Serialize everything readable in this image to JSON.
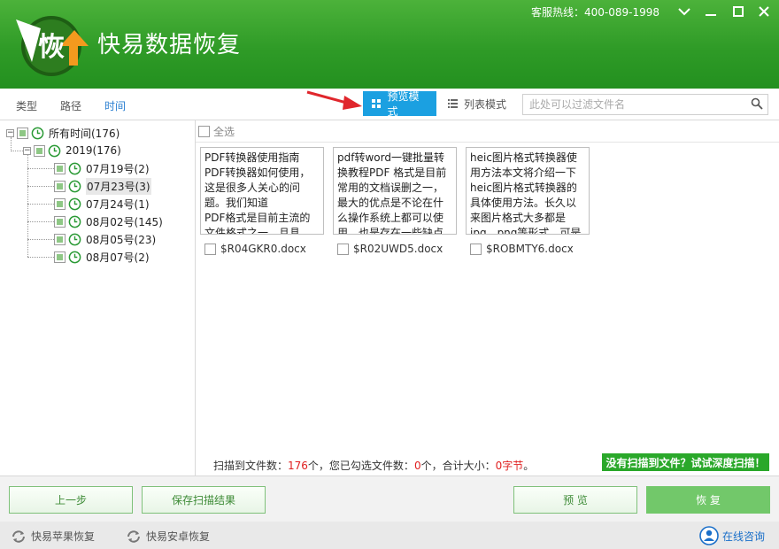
{
  "app": {
    "title": "快易数据恢复",
    "logo_char": "恢"
  },
  "header": {
    "hotline": "客服热线：400-089-1998"
  },
  "tabs": [
    {
      "label": "类型"
    },
    {
      "label": "路径"
    },
    {
      "label": "时间",
      "active": true
    }
  ],
  "view_modes": {
    "preview": "预览模式",
    "list": "列表模式"
  },
  "search": {
    "placeholder": "此处可以过滤文件名"
  },
  "tree": {
    "root": "所有时间(176)",
    "year": "2019(176)",
    "dates": [
      "07月19号(2)",
      "07月23号(3)",
      "07月24号(1)",
      "08月02号(145)",
      "08月05号(23)",
      "08月07号(2)"
    ],
    "selected_index": 1
  },
  "content": {
    "select_all": "全选",
    "cards": [
      {
        "preview": "PDF转换器使用指南PDF转换器如何使用，这是很多人关心的问题。我们知道\nPDF格式是目前主流的文件格式之一，且具",
        "filename": "$R04GKR0.docx"
      },
      {
        "preview": "pdf转word一键批量转换教程PDF 格式是目前常用的文档误删之一，最大的优点是不论在什么操作系统上都可以使用，也是存在一些缺点",
        "filename": "$R02UWD5.docx"
      },
      {
        "preview": "heic图片格式转换器使用方法本文将介绍一下heic图片格式转换器的具体使用方法。长久以来图片格式大多都是jpg、png等形式，可是自",
        "filename": "$ROBMTY6.docx"
      }
    ]
  },
  "status": {
    "prefix": "扫描到文件数：",
    "found_count": "176",
    "mid": "个，您已勾选文件数：",
    "checked_count": "0",
    "mid2": "个，合计大小：",
    "size": "0字节",
    "suffix": "。",
    "deep_scan": "没有扫描到文件？试试深度扫描！"
  },
  "buttons": {
    "back": "上一步",
    "save": "保存扫描结果",
    "preview": "预 览",
    "recover": "恢 复"
  },
  "footer": {
    "apple": "快易苹果恢复",
    "android": "快易安卓恢复",
    "consult": "在线咨询"
  },
  "colors": {
    "header_green": "#2f9b27",
    "accent_blue": "#1ba0e1",
    "highlight_red": "#e02020",
    "button_green": "#72c86a"
  }
}
